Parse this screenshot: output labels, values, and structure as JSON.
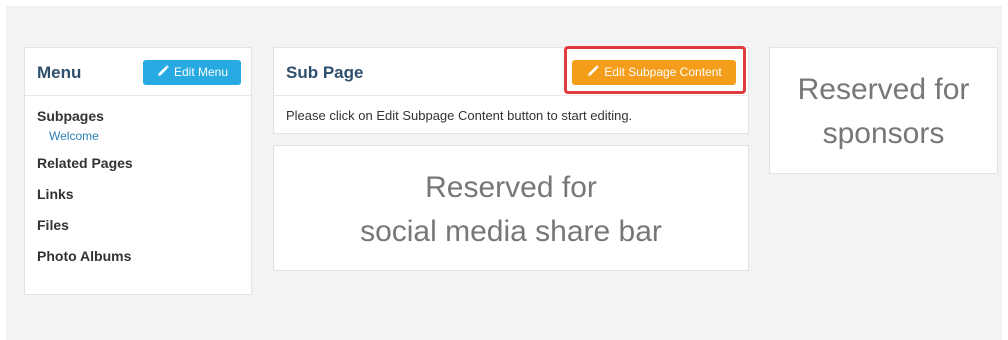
{
  "menu": {
    "title": "Menu",
    "edit_button": "Edit Menu",
    "sections": {
      "subpages": "Subpages",
      "subpage_item": "Welcome",
      "related": "Related Pages",
      "links": "Links",
      "files": "Files",
      "albums": "Photo Albums"
    }
  },
  "subpage": {
    "title": "Sub Page",
    "edit_button": "Edit Subpage Content",
    "message": "Please click on Edit Subpage Content button to start editing."
  },
  "placeholders": {
    "share_line1": "Reserved for",
    "share_line2": "social media share bar",
    "sponsor_line1": "Reserved for",
    "sponsor_line2": "sponsors"
  },
  "colors": {
    "background": "#f3f3f3",
    "primary_button": "#27a9e1",
    "warning_button": "#f49d1a",
    "highlight": "#e03b3f"
  },
  "icons": {
    "edit_menu": "pencil-icon",
    "edit_subpage": "pencil-icon"
  }
}
